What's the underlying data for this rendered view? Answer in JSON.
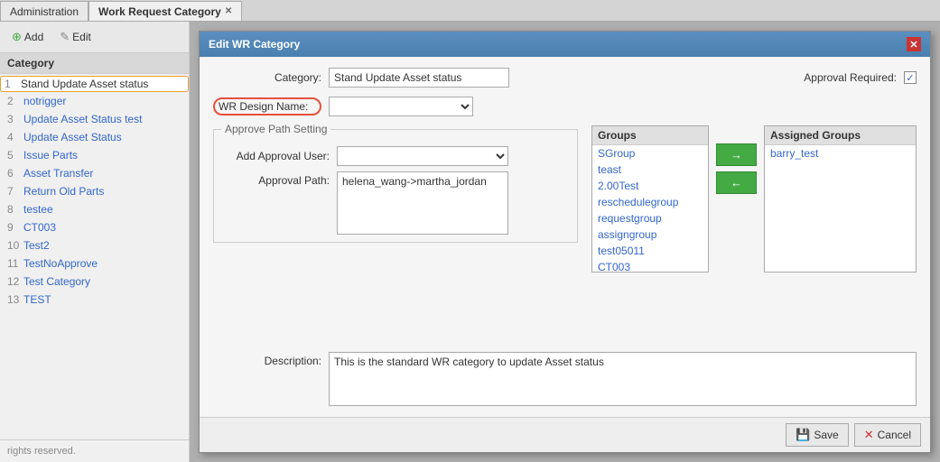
{
  "tabs": [
    {
      "label": "Administration",
      "active": false,
      "closeable": false
    },
    {
      "label": "Work Request Category",
      "active": true,
      "closeable": true
    }
  ],
  "sidebar": {
    "add_label": "Add",
    "edit_label": "Edit",
    "header": "Category",
    "items": [
      {
        "num": "1",
        "name": "Stand Update Asset status",
        "selected": true
      },
      {
        "num": "2",
        "name": "notrigger",
        "selected": false
      },
      {
        "num": "3",
        "name": "Update Asset Status test",
        "selected": false
      },
      {
        "num": "4",
        "name": "Update Asset Status",
        "selected": false
      },
      {
        "num": "5",
        "name": "Issue Parts",
        "selected": false
      },
      {
        "num": "6",
        "name": "Asset Transfer",
        "selected": false
      },
      {
        "num": "7",
        "name": "Return Old Parts",
        "selected": false
      },
      {
        "num": "8",
        "name": "testee",
        "selected": false
      },
      {
        "num": "9",
        "name": "CT003",
        "selected": false
      },
      {
        "num": "10",
        "name": "Test2",
        "selected": false
      },
      {
        "num": "11",
        "name": "TestNoApprove",
        "selected": false
      },
      {
        "num": "12",
        "name": "Test Category",
        "selected": false
      },
      {
        "num": "13",
        "name": "TEST",
        "selected": false
      }
    ],
    "footer": "rights reserved."
  },
  "modal": {
    "title": "Edit WR Category",
    "category_label": "Category:",
    "category_value": "Stand Update Asset status",
    "wr_design_label": "WR Design Name:",
    "wr_design_value": "",
    "approve_path_section": "Approve Path Setting",
    "add_approval_label": "Add Approval User:",
    "approval_path_label": "Approval Path:",
    "approval_path_value": "helena_wang->martha_jordan",
    "approval_required_label": "Approval Required:",
    "groups_header": "Groups",
    "assigned_groups_header": "Assigned Groups",
    "groups": [
      "SGroup",
      "teast",
      "2.00Test",
      "reschedulegroup",
      "requestgroup",
      "assigngroup",
      "test05011",
      "CT003"
    ],
    "assigned_groups": [
      "barry_test"
    ],
    "arrow_right": "→",
    "arrow_left": "←",
    "description_label": "Description:",
    "description_value": "This is the standard WR category to update Asset status",
    "save_label": "Save",
    "cancel_label": "Cancel"
  }
}
